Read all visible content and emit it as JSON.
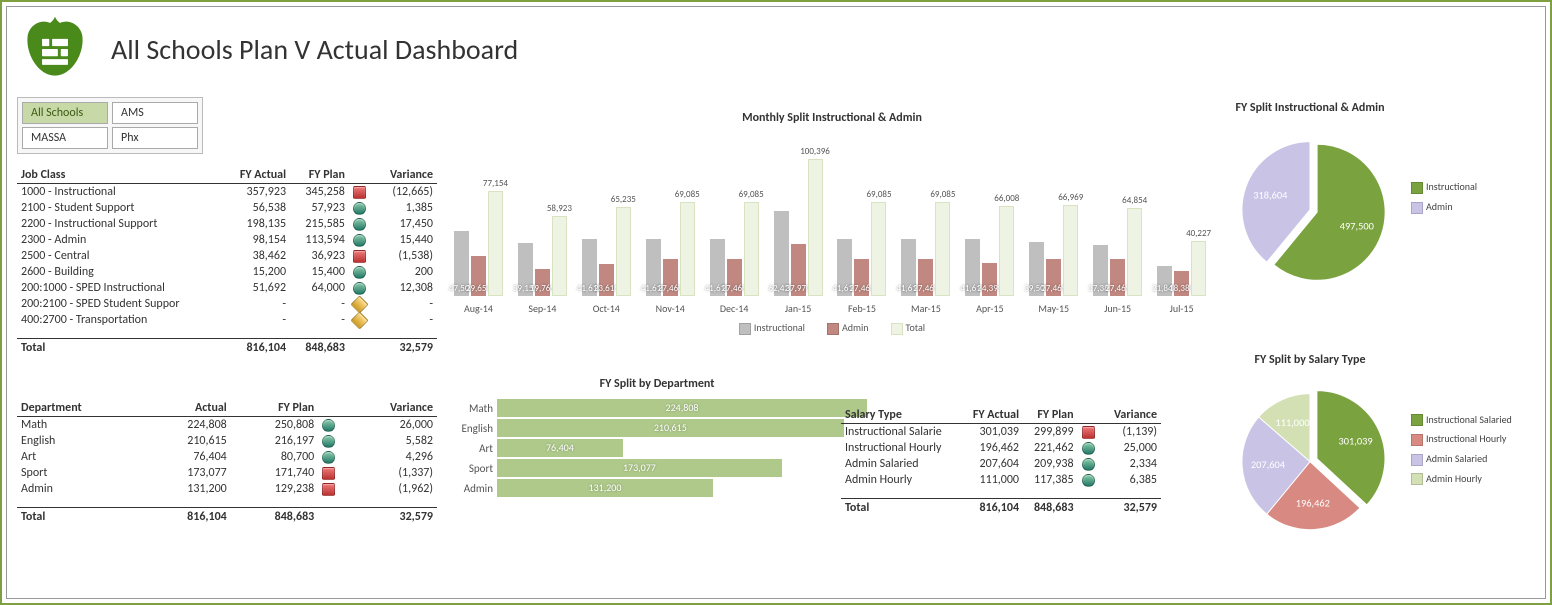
{
  "title": "All Schools Plan V Actual Dashboard",
  "filters": [
    [
      "All Schools",
      "AMS"
    ],
    [
      "MASSA",
      "Phx"
    ]
  ],
  "filters_selected": "All Schools",
  "jobclass": {
    "headers": [
      "Job Class",
      "FY Actual",
      "FY Plan",
      "",
      "Variance"
    ],
    "rows": [
      {
        "n": "1000 - Instructional",
        "a": "357,923",
        "p": "345,258",
        "i": "r",
        "v": "(12,665)"
      },
      {
        "n": "2100 - Student Support",
        "a": "56,538",
        "p": "57,923",
        "i": "g",
        "v": "1,385"
      },
      {
        "n": "2200 - Instructional Support",
        "a": "198,135",
        "p": "215,585",
        "i": "g",
        "v": "17,450"
      },
      {
        "n": "2300 - Admin",
        "a": "98,154",
        "p": "113,594",
        "i": "g",
        "v": "15,440"
      },
      {
        "n": "2500 - Central",
        "a": "38,462",
        "p": "36,923",
        "i": "r",
        "v": "(1,538)"
      },
      {
        "n": "2600 - Building",
        "a": "15,200",
        "p": "15,400",
        "i": "g",
        "v": "200"
      },
      {
        "n": "200:1000 - SPED Instructional",
        "a": "51,692",
        "p": "64,000",
        "i": "g",
        "v": "12,308"
      },
      {
        "n": "200:2100 - SPED Student Suppor",
        "a": "-",
        "p": "-",
        "i": "y",
        "v": "-"
      },
      {
        "n": "400:2700 - Transportation",
        "a": "-",
        "p": "-",
        "i": "y",
        "v": "-"
      }
    ],
    "total": {
      "n": "Total",
      "a": "816,104",
      "p": "848,683",
      "v": "32,579"
    }
  },
  "dept": {
    "headers": [
      "Department",
      "Actual",
      "FY Plan",
      "",
      "Variance"
    ],
    "rows": [
      {
        "n": "Math",
        "a": "224,808",
        "p": "250,808",
        "i": "g",
        "v": "26,000"
      },
      {
        "n": "English",
        "a": "210,615",
        "p": "216,197",
        "i": "g",
        "v": "5,582"
      },
      {
        "n": "Art",
        "a": "76,404",
        "p": "80,700",
        "i": "g",
        "v": "4,296"
      },
      {
        "n": "Sport",
        "a": "173,077",
        "p": "171,740",
        "i": "r",
        "v": "(1,337)"
      },
      {
        "n": "Admin",
        "a": "131,200",
        "p": "129,238",
        "i": "r",
        "v": "(1,962)"
      }
    ],
    "total": {
      "n": "Total",
      "a": "816,104",
      "p": "848,683",
      "v": "32,579"
    }
  },
  "salary": {
    "headers": [
      "Salary Type",
      "FY Actual",
      "FY Plan",
      "",
      "Variance"
    ],
    "rows": [
      {
        "n": "Instructional Salarie",
        "a": "301,039",
        "p": "299,899",
        "i": "r",
        "v": "(1,139)"
      },
      {
        "n": "Instructional Hourly",
        "a": "196,462",
        "p": "221,462",
        "i": "g",
        "v": "25,000"
      },
      {
        "n": "Admin Salaried",
        "a": "207,604",
        "p": "209,938",
        "i": "g",
        "v": "2,334"
      },
      {
        "n": "Admin Hourly",
        "a": "111,000",
        "p": "117,385",
        "i": "g",
        "v": "6,385"
      }
    ],
    "total": {
      "n": "Total",
      "a": "816,104",
      "p": "848,683",
      "v": "32,579"
    }
  },
  "monthly": {
    "title": "Monthly Split Instructional & Admin",
    "legend": [
      "Instructional",
      "Admin",
      "Total"
    ]
  },
  "pie1": {
    "title": "FY Split Instructional & Admin",
    "legend": [
      "Instructional",
      "Admin"
    ],
    "labels": [
      "497,500",
      "318,604"
    ]
  },
  "pie2": {
    "title": "FY Split by Salary Type",
    "legend": [
      "Instructional Salaried",
      "Instructional Hourly",
      "Admin Salaried",
      "Admin Hourly"
    ],
    "labels": [
      "301,039",
      "196,462",
      "207,604",
      "111,000"
    ]
  },
  "deptchart": {
    "title": "FY Split by Department"
  },
  "chart_data": [
    {
      "type": "bar",
      "title": "Monthly Split Instructional & Admin",
      "categories": [
        "Aug-14",
        "Sep-14",
        "Oct-14",
        "Nov-14",
        "Dec-14",
        "Jan-15",
        "Feb-15",
        "Mar-15",
        "Apr-15",
        "May-15",
        "Jun-15",
        "Jul-15"
      ],
      "series": [
        {
          "name": "Instructional",
          "values": [
            47500,
            39154,
            41615,
            41615,
            41615,
            62423,
            41615,
            41615,
            41615,
            39500,
            37385,
            21846
          ]
        },
        {
          "name": "Admin",
          "values": [
            29654,
            19769,
            23615,
            27469,
            27469,
            37973,
            27469,
            27469,
            24392,
            27469,
            27469,
            18381
          ]
        },
        {
          "name": "Total",
          "values": [
            77154,
            58923,
            65235,
            69085,
            69085,
            100396,
            69085,
            69085,
            66008,
            66969,
            64854,
            40227
          ]
        }
      ],
      "ylim": [
        0,
        110000
      ]
    },
    {
      "type": "bar",
      "title": "FY Split by Department",
      "orientation": "horizontal",
      "categories": [
        "Math",
        "English",
        "Art",
        "Sport",
        "Admin"
      ],
      "values": [
        224808,
        210615,
        76404,
        173077,
        131200
      ]
    },
    {
      "type": "pie",
      "title": "FY Split Instructional & Admin",
      "categories": [
        "Instructional",
        "Admin"
      ],
      "values": [
        497500,
        318604
      ],
      "colors": [
        "#7aa23f",
        "#c9c3e6"
      ]
    },
    {
      "type": "pie",
      "title": "FY Split by Salary Type",
      "categories": [
        "Instructional Salaried",
        "Instructional Hourly",
        "Admin Salaried",
        "Admin Hourly"
      ],
      "values": [
        301039,
        196462,
        207604,
        111000
      ],
      "colors": [
        "#7aa23f",
        "#d88a82",
        "#c9c3e6",
        "#d2e0b4"
      ]
    }
  ]
}
